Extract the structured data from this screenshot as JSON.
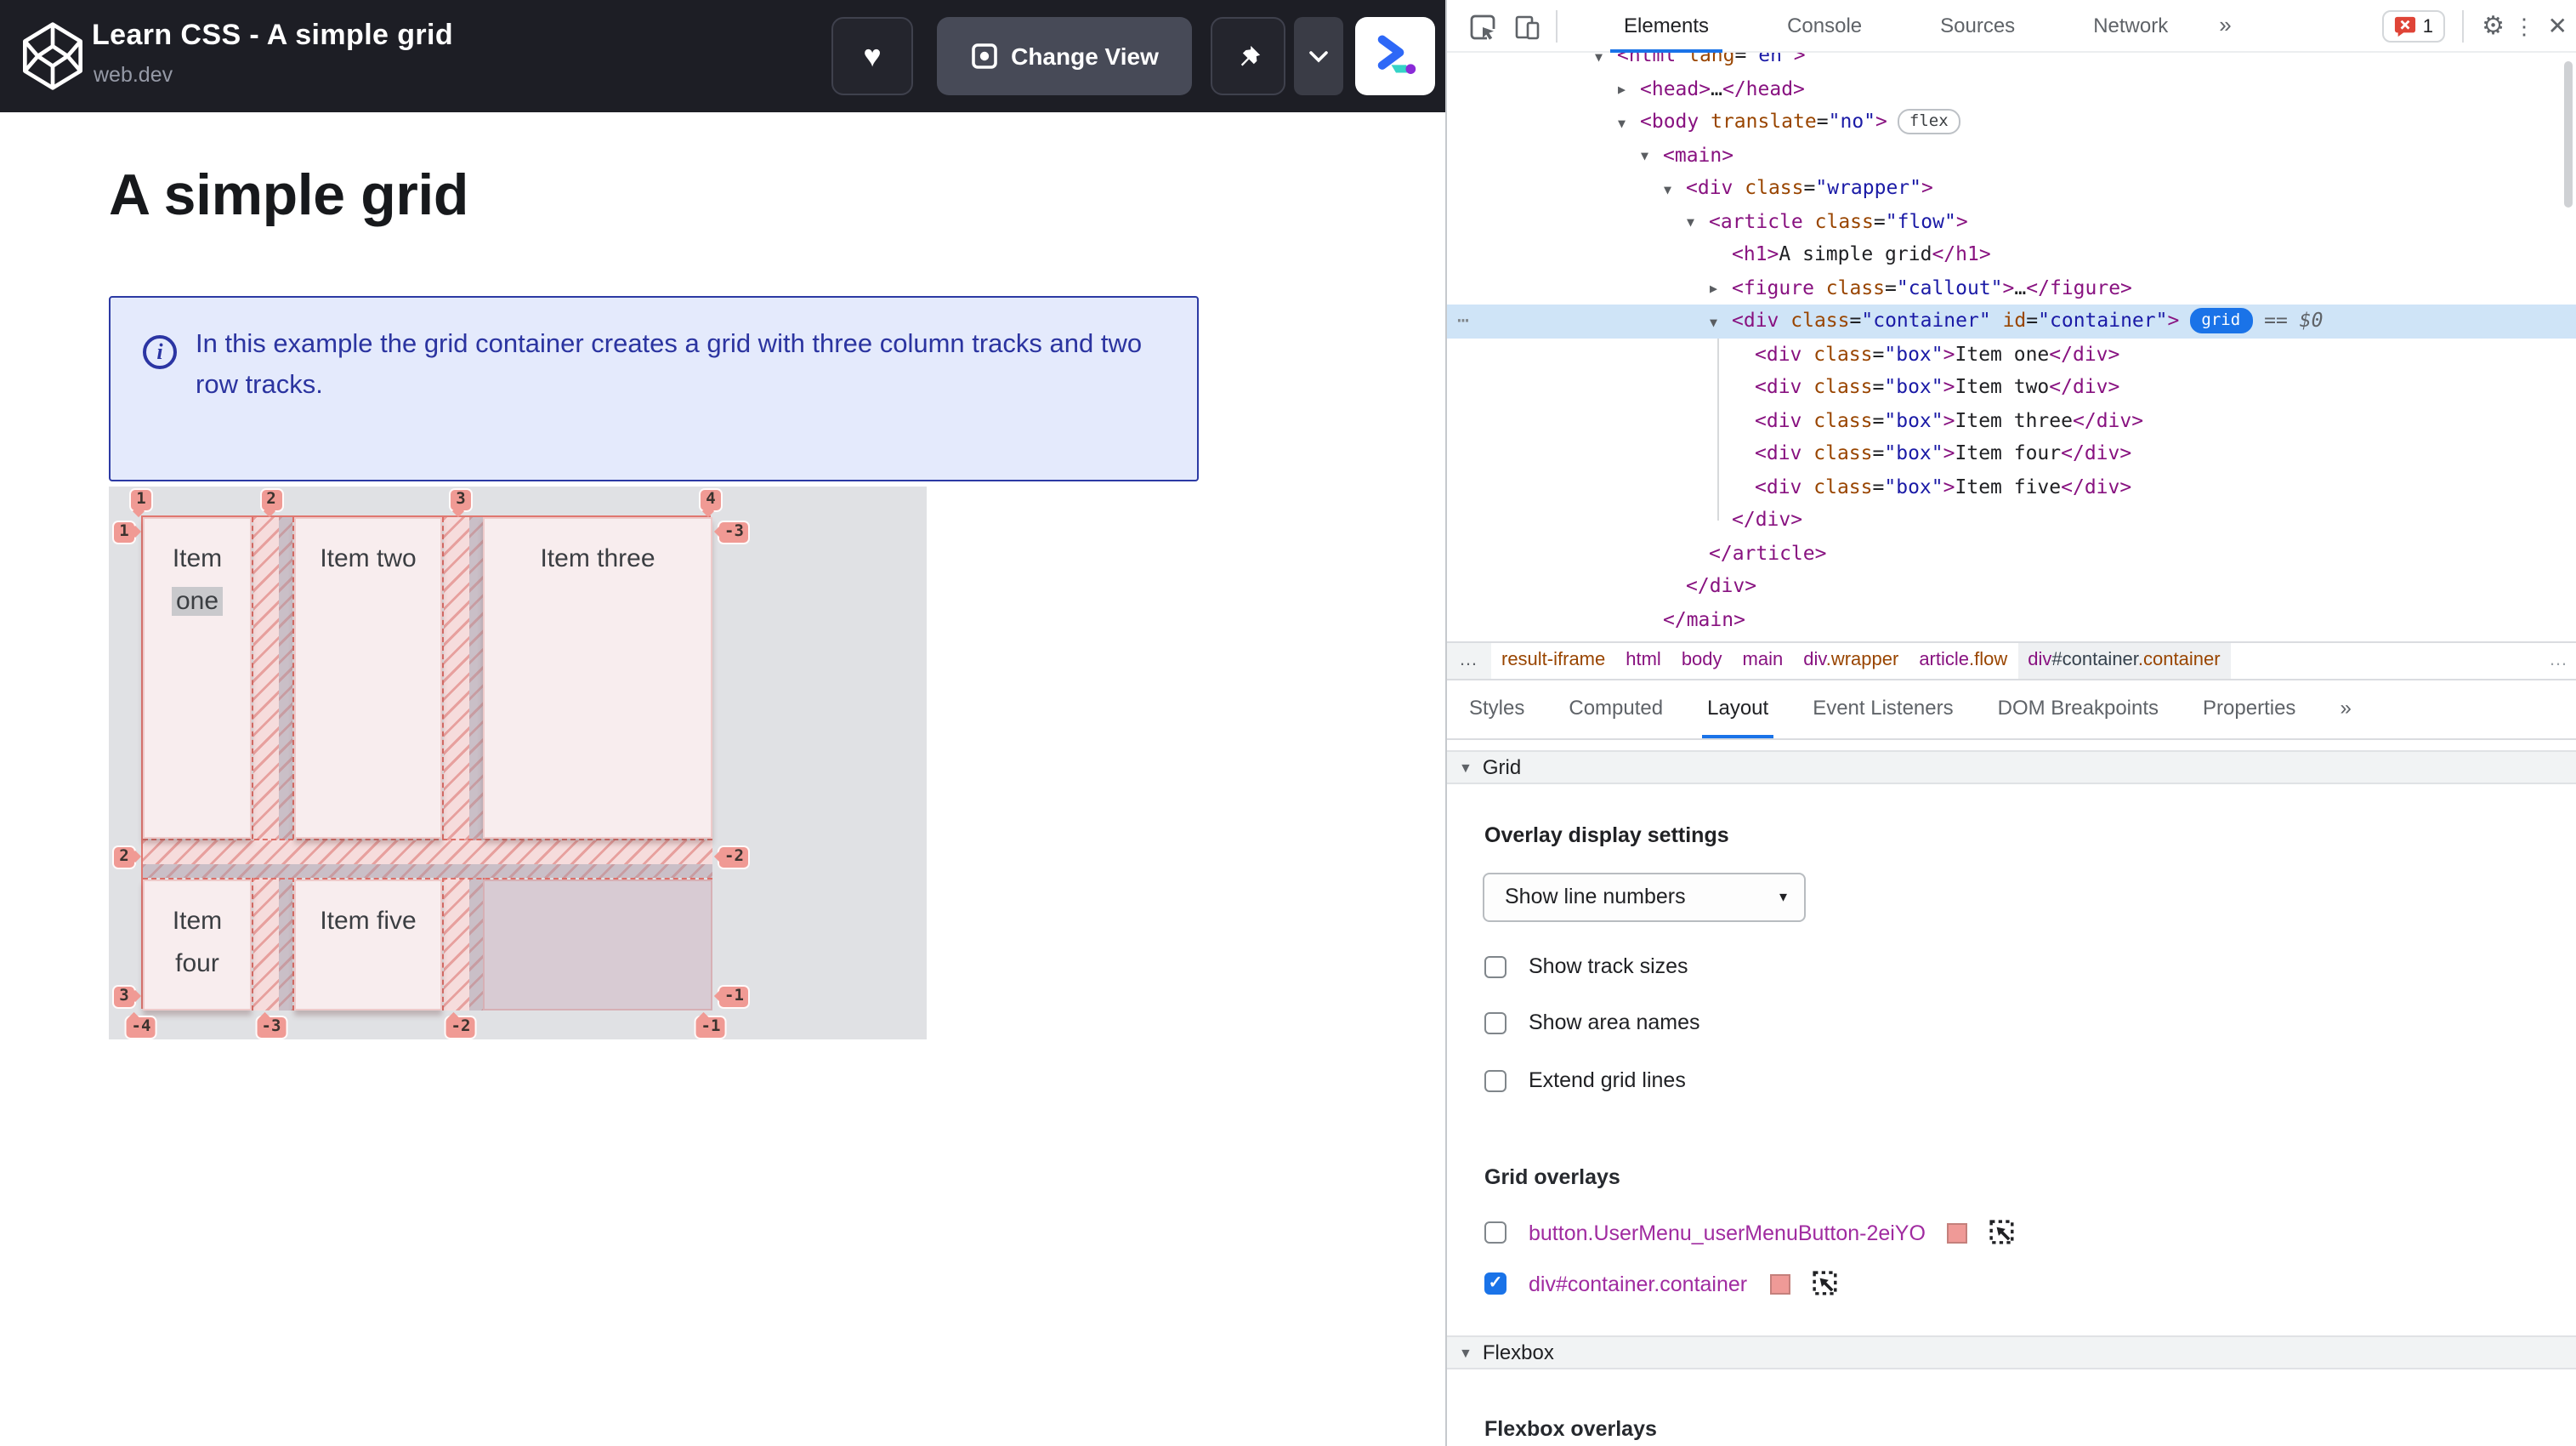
{
  "embed": {
    "title": "Learn CSS - A simple grid",
    "site": "web.dev",
    "change_view_label": "Change View"
  },
  "page": {
    "heading": "A simple grid",
    "callout_text": "In this example the grid container creates a grid with three column tracks and two row tracks."
  },
  "grid_demo": {
    "items": [
      {
        "lines": [
          {
            "t": "Item"
          },
          {
            "t": "one",
            "hl": true
          }
        ]
      },
      {
        "lines": [
          {
            "t": "Item two"
          }
        ]
      },
      {
        "lines": [
          {
            "t": "Item three"
          }
        ]
      },
      {
        "lines": [
          {
            "t": "Item"
          },
          {
            "t": "four"
          }
        ]
      },
      {
        "lines": [
          {
            "t": "Item five"
          }
        ]
      }
    ],
    "line_numbers": {
      "top": [
        "1",
        "2",
        "3",
        "4"
      ],
      "bottom": [
        "-4",
        "-3",
        "-2",
        "-1"
      ],
      "left": [
        "1",
        "2",
        "3"
      ],
      "right": [
        "-3",
        "-2",
        "-1"
      ]
    }
  },
  "devtools": {
    "tabs": [
      "Elements",
      "Console",
      "Sources",
      "Network"
    ],
    "active_tab": "Elements",
    "more_glyph": "»",
    "error_count": "1",
    "dom_tree": [
      {
        "level": 0,
        "arrow": "open",
        "tokens": [
          [
            "p",
            "<html"
          ],
          [
            "a",
            " lang"
          ],
          [
            "t",
            "="
          ],
          [
            "v",
            "\"en\""
          ],
          [
            "p",
            ">"
          ]
        ]
      },
      {
        "level": 1,
        "arrow": "closed",
        "tokens": [
          [
            "p",
            "<head>"
          ],
          [
            "t",
            "…"
          ],
          [
            "p",
            "</head>"
          ]
        ]
      },
      {
        "level": 1,
        "arrow": "open",
        "chip": "flex",
        "tokens": [
          [
            "p",
            "<body"
          ],
          [
            "a",
            " translate"
          ],
          [
            "t",
            "="
          ],
          [
            "v",
            "\"no\""
          ],
          [
            "p",
            ">"
          ]
        ]
      },
      {
        "level": 2,
        "arrow": "open",
        "tokens": [
          [
            "p",
            "<main>"
          ]
        ]
      },
      {
        "level": 3,
        "arrow": "open",
        "tokens": [
          [
            "p",
            "<div"
          ],
          [
            "a",
            " class"
          ],
          [
            "t",
            "="
          ],
          [
            "v",
            "\"wrapper\""
          ],
          [
            "p",
            ">"
          ]
        ]
      },
      {
        "level": 4,
        "arrow": "open",
        "tokens": [
          [
            "p",
            "<article"
          ],
          [
            "a",
            " class"
          ],
          [
            "t",
            "="
          ],
          [
            "v",
            "\"flow\""
          ],
          [
            "p",
            ">"
          ]
        ]
      },
      {
        "level": 5,
        "tokens": [
          [
            "p",
            "<h1>"
          ],
          [
            "t",
            "A simple grid"
          ],
          [
            "p",
            "</h1>"
          ]
        ]
      },
      {
        "level": 5,
        "arrow": "closed",
        "tokens": [
          [
            "p",
            "<figure"
          ],
          [
            "a",
            " class"
          ],
          [
            "t",
            "="
          ],
          [
            "v",
            "\"callout\""
          ],
          [
            "p",
            ">"
          ],
          [
            "t",
            "…"
          ],
          [
            "p",
            "</figure>"
          ]
        ]
      },
      {
        "level": 5,
        "arrow": "open",
        "selected": true,
        "chip": "grid",
        "suffix_eq": "==",
        "suffix_var": "$0",
        "tokens": [
          [
            "p",
            "<div"
          ],
          [
            "a",
            " class"
          ],
          [
            "t",
            "="
          ],
          [
            "v",
            "\"container\""
          ],
          [
            "a",
            " id"
          ],
          [
            "t",
            "="
          ],
          [
            "v",
            "\"container\""
          ],
          [
            "p",
            ">"
          ]
        ]
      },
      {
        "level": 6,
        "tokens": [
          [
            "p",
            "<div"
          ],
          [
            "a",
            " class"
          ],
          [
            "t",
            "="
          ],
          [
            "v",
            "\"box\""
          ],
          [
            "p",
            ">"
          ],
          [
            "t",
            "Item one"
          ],
          [
            "p",
            "</div>"
          ]
        ]
      },
      {
        "level": 6,
        "tokens": [
          [
            "p",
            "<div"
          ],
          [
            "a",
            " class"
          ],
          [
            "t",
            "="
          ],
          [
            "v",
            "\"box\""
          ],
          [
            "p",
            ">"
          ],
          [
            "t",
            "Item two"
          ],
          [
            "p",
            "</div>"
          ]
        ]
      },
      {
        "level": 6,
        "tokens": [
          [
            "p",
            "<div"
          ],
          [
            "a",
            " class"
          ],
          [
            "t",
            "="
          ],
          [
            "v",
            "\"box\""
          ],
          [
            "p",
            ">"
          ],
          [
            "t",
            "Item three"
          ],
          [
            "p",
            "</div>"
          ]
        ]
      },
      {
        "level": 6,
        "tokens": [
          [
            "p",
            "<div"
          ],
          [
            "a",
            " class"
          ],
          [
            "t",
            "="
          ],
          [
            "v",
            "\"box\""
          ],
          [
            "p",
            ">"
          ],
          [
            "t",
            "Item four"
          ],
          [
            "p",
            "</div>"
          ]
        ]
      },
      {
        "level": 6,
        "tokens": [
          [
            "p",
            "<div"
          ],
          [
            "a",
            " class"
          ],
          [
            "t",
            "="
          ],
          [
            "v",
            "\"box\""
          ],
          [
            "p",
            ">"
          ],
          [
            "t",
            "Item five"
          ],
          [
            "p",
            "</div>"
          ]
        ]
      },
      {
        "level": 5,
        "tokens": [
          [
            "p",
            "</div>"
          ]
        ]
      },
      {
        "level": 4,
        "tokens": [
          [
            "p",
            "</article>"
          ]
        ]
      },
      {
        "level": 3,
        "tokens": [
          [
            "p",
            "</div>"
          ]
        ]
      },
      {
        "level": 2,
        "tokens": [
          [
            "p",
            "</main>"
          ]
        ]
      }
    ],
    "dom_badges": {
      "flex": "flex",
      "grid": "grid"
    },
    "gutter_dots": "⋯",
    "breadcrumbs": {
      "overflow_left": "…",
      "overflow_right": "…",
      "items": [
        {
          "parts": [
            [
              "fr",
              "result-iframe"
            ]
          ]
        },
        {
          "parts": [
            [
              "tag",
              "html"
            ]
          ]
        },
        {
          "parts": [
            [
              "tag",
              "body"
            ]
          ]
        },
        {
          "parts": [
            [
              "tag",
              "main"
            ]
          ]
        },
        {
          "parts": [
            [
              "tag",
              "div"
            ],
            [
              "cls",
              ".wrapper"
            ]
          ]
        },
        {
          "parts": [
            [
              "tag",
              "article"
            ],
            [
              "cls",
              ".flow"
            ]
          ]
        },
        {
          "parts": [
            [
              "tag",
              "div"
            ],
            [
              "id",
              "#container"
            ],
            [
              "cls",
              ".container"
            ]
          ],
          "selected": true
        }
      ]
    },
    "sidebar_tabs": [
      "Styles",
      "Computed",
      "Layout",
      "Event Listeners",
      "DOM Breakpoints",
      "Properties"
    ],
    "sidebar_active_tab": "Layout",
    "sidebar_more_glyph": "»",
    "layout_panel": {
      "grid_section": "Grid",
      "overlay_settings_label": "Overlay display settings",
      "dropdown_value": "Show line numbers",
      "checkboxes": [
        {
          "label": "Show track sizes",
          "checked": false
        },
        {
          "label": "Show area names",
          "checked": false
        },
        {
          "label": "Extend grid lines",
          "checked": false
        }
      ],
      "grid_overlays_label": "Grid overlays",
      "overlays": [
        {
          "selector": "button.UserMenu_userMenuButton-2eiYO",
          "checked": false
        },
        {
          "selector": "div#container.container",
          "checked": true
        }
      ],
      "flexbox_section": "Flexbox",
      "flexbox_overlays_label": "Flexbox overlays"
    }
  },
  "colors": {
    "accent_blue": "#1a73e8",
    "overlay_salmon": "#f09a94",
    "selection_blue": "#cfe4f7",
    "error_red": "#df4437",
    "callout_blue": "#2c3aa4",
    "tag_purple": "#881280",
    "attr_orange": "#994500",
    "value_blue": "#1a1aa6"
  }
}
